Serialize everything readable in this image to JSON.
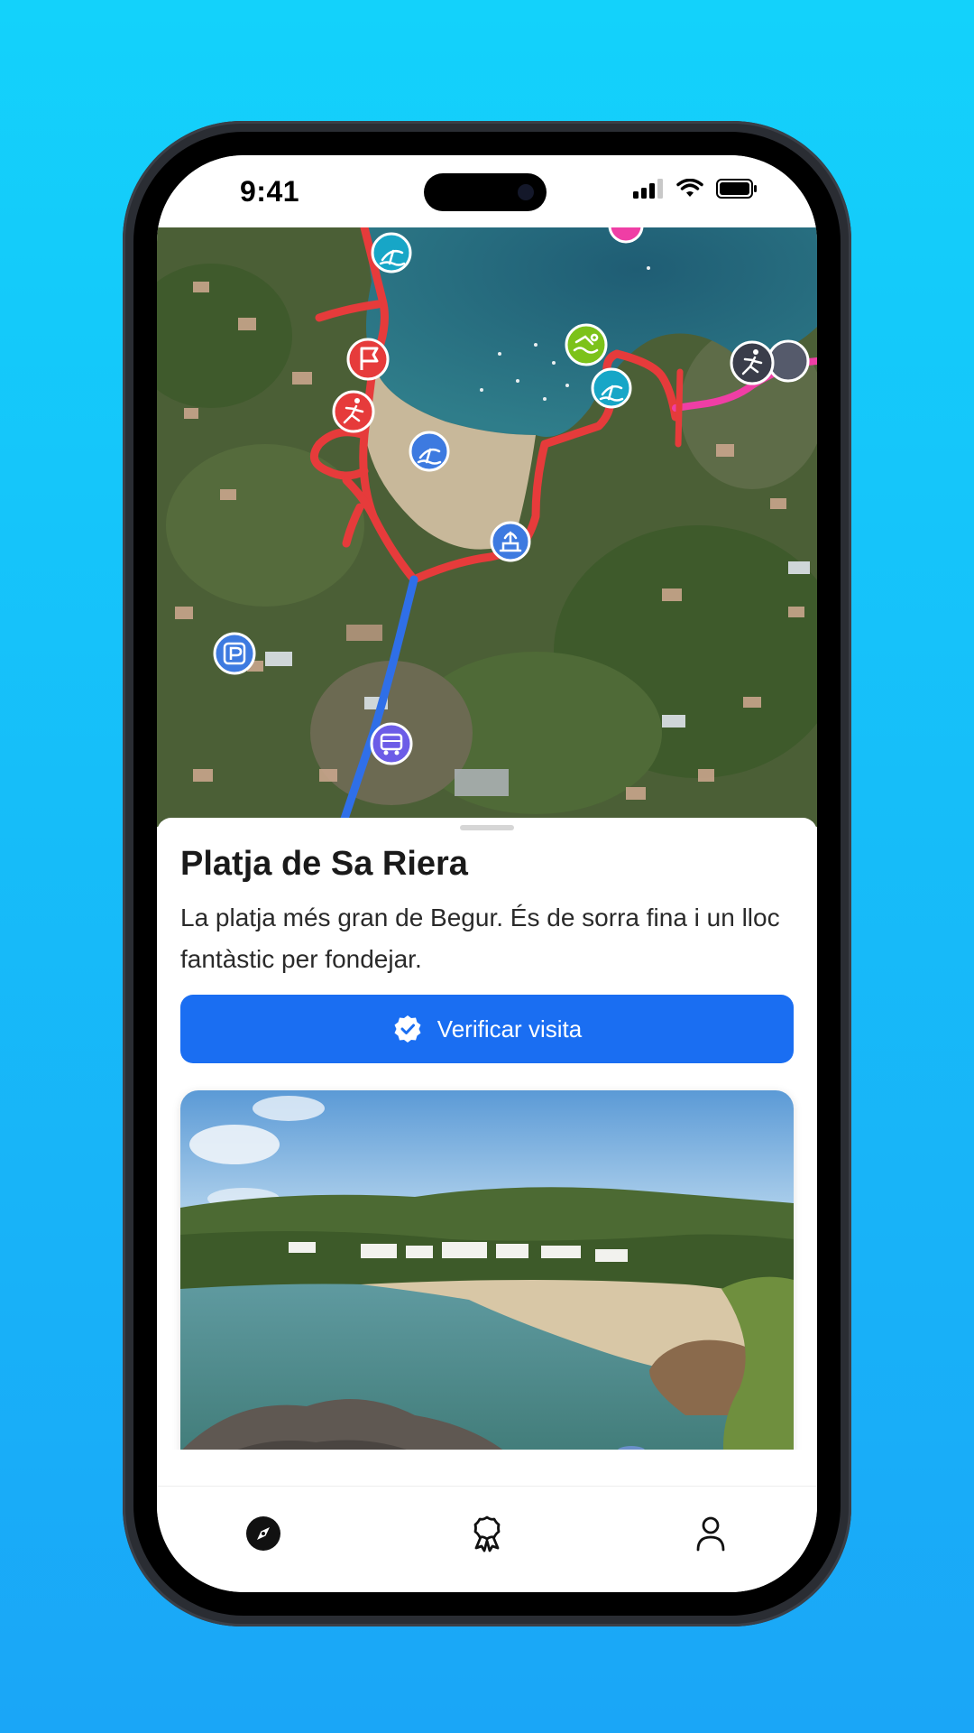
{
  "status_bar": {
    "time": "9:41"
  },
  "map": {
    "pois": [
      {
        "icon": "beach-umbrella-icon",
        "color": "#17a6c7"
      },
      {
        "icon": "flag-icon",
        "color": "#e63b3b"
      },
      {
        "icon": "hiking-icon",
        "color": "#e63b3b"
      },
      {
        "icon": "beach-umbrella-icon",
        "color": "#3d7ae0"
      },
      {
        "icon": "swimming-icon",
        "color": "#7cc21a"
      },
      {
        "icon": "beach-umbrella-icon",
        "color": "#17a6c7"
      },
      {
        "icon": "hiking-icon",
        "color": "#3a3d4a"
      },
      {
        "icon": "fountain-icon",
        "color": "#3d7ae0"
      },
      {
        "icon": "parking-icon",
        "color": "#3d7ae0"
      },
      {
        "icon": "bus-icon",
        "color": "#6c5ce7"
      }
    ]
  },
  "place": {
    "title": "Platja de Sa Riera",
    "description": "La platja més gran de Begur. És de sorra fina i un lloc fantàstic per fondejar."
  },
  "actions": {
    "verify_label": "Verificar visita"
  },
  "tabs": [
    {
      "icon": "compass-icon",
      "name": "tab-explore"
    },
    {
      "icon": "award-icon",
      "name": "tab-achievements"
    },
    {
      "icon": "user-icon",
      "name": "tab-profile"
    }
  ],
  "colors": {
    "accent": "#1a6ef2",
    "route": "#e63b3b",
    "path": "#2f6fe8",
    "background_top": "#13d2fb",
    "background_bottom": "#1aa6f7"
  }
}
